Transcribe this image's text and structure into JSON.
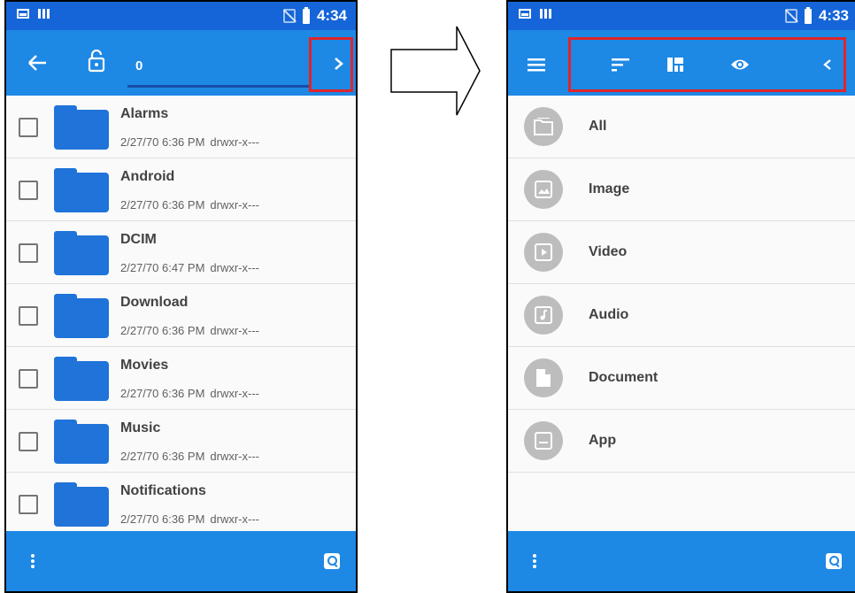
{
  "left_screen": {
    "status_time": "4:34",
    "path_count": "0",
    "files": [
      {
        "name": "Alarms",
        "date": "2/27/70 6:36 PM",
        "perms": "drwxr-x---"
      },
      {
        "name": "Android",
        "date": "2/27/70 6:36 PM",
        "perms": "drwxr-x---"
      },
      {
        "name": "DCIM",
        "date": "2/27/70 6:47 PM",
        "perms": "drwxr-x---"
      },
      {
        "name": "Download",
        "date": "2/27/70 6:36 PM",
        "perms": "drwxr-x---"
      },
      {
        "name": "Movies",
        "date": "2/27/70 6:36 PM",
        "perms": "drwxr-x---"
      },
      {
        "name": "Music",
        "date": "2/27/70 6:36 PM",
        "perms": "drwxr-x---"
      },
      {
        "name": "Notifications",
        "date": "2/27/70 6:36 PM",
        "perms": "drwxr-x---"
      }
    ]
  },
  "right_screen": {
    "status_time": "4:33",
    "categories": [
      {
        "label": "All",
        "icon": "folder-icon"
      },
      {
        "label": "Image",
        "icon": "image-icon"
      },
      {
        "label": "Video",
        "icon": "video-icon"
      },
      {
        "label": "Audio",
        "icon": "audio-icon"
      },
      {
        "label": "Document",
        "icon": "document-icon"
      },
      {
        "label": "App",
        "icon": "app-icon"
      }
    ]
  },
  "colors": {
    "status_bar": "#1565d8",
    "app_bar": "#1e88e5",
    "highlight": "#e0242a",
    "folder": "#1f73d9"
  }
}
